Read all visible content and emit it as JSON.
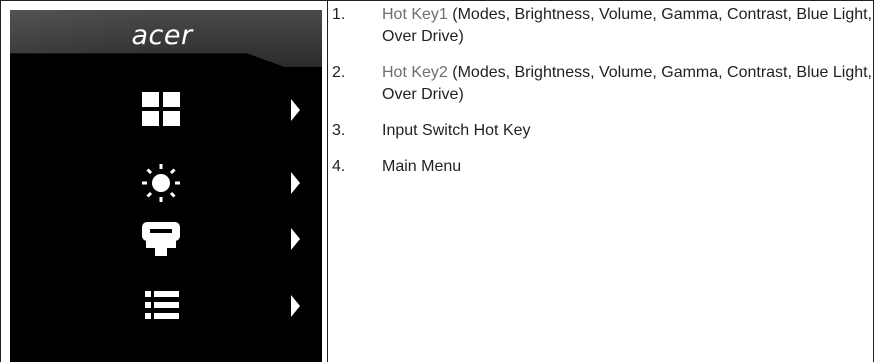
{
  "osd": {
    "logo": "acer",
    "icons": [
      "modes-icon",
      "brightness-icon",
      "input-source-icon",
      "menu-icon"
    ]
  },
  "list": [
    {
      "number": "1.",
      "lead": "Hot Key1",
      "rest": " (Modes, Brightness, Volume, Gamma, Contrast, Blue Light, Over Drive)"
    },
    {
      "number": "2.",
      "lead": "Hot Key2",
      "rest": " (Modes, Brightness, Volume, Gamma, Contrast, Blue Light, Over Drive)"
    },
    {
      "number": "3.",
      "lead": "",
      "rest": "Input Switch Hot Key"
    },
    {
      "number": "4.",
      "lead": "",
      "rest": "Main Menu"
    }
  ]
}
